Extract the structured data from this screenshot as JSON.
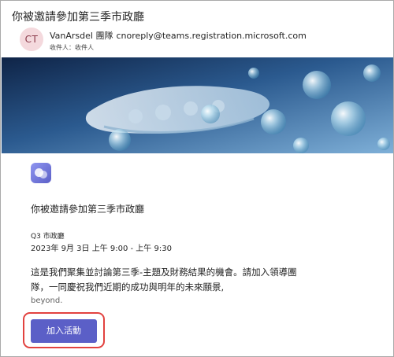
{
  "email": {
    "subject": "你被邀請參加第三季市政廳",
    "avatar_initials": "CT",
    "sender_name": "VanArsdel 團隊",
    "sender_address": "cnoreply@teams.registration.microsoft.com",
    "to_line": "收件人：收件人"
  },
  "event": {
    "app_icon": "teams-events-icon",
    "title": "你被邀請參加第三季市政廳",
    "name": "Q3 市政廳",
    "time": "2023年 9月 3日 上午 9:00 - 上午 9:30",
    "description": "這是我們聚集並討論第三季-主題及財務結果的機會。請加入領導團隊，一同慶祝我們近期的成功與明年的未來願景,",
    "description_more": "beyond.",
    "join_button_label": "加入活動"
  },
  "colors": {
    "accent": "#5b5fc7",
    "highlight": "#e2423f",
    "avatar_bg": "#f4d9dd"
  }
}
